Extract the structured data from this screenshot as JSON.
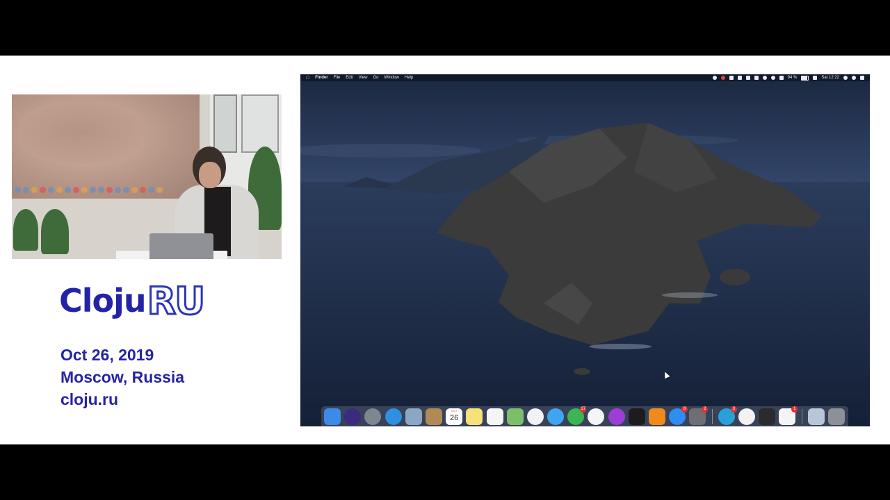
{
  "logo": {
    "text_main": "Cloju",
    "text_accent": "RU"
  },
  "event": {
    "date": "Oct 26, 2019",
    "location": "Moscow, Russia",
    "website": "cloju.ru"
  },
  "menubar": {
    "app": "Finder",
    "items": [
      "File",
      "Edit",
      "View",
      "Go",
      "Window",
      "Help"
    ],
    "battery": "94 %",
    "clock": "Sat 12:22"
  },
  "dock": {
    "calendar": {
      "month": "OCT",
      "day": "26"
    },
    "items": [
      {
        "name": "finder",
        "color": "#3d8be6"
      },
      {
        "name": "siri",
        "color": "#3b2a7e"
      },
      {
        "name": "launchpad",
        "color": "#7f8690"
      },
      {
        "name": "safari",
        "color": "#2f8fe0"
      },
      {
        "name": "mail",
        "color": "#8aa7c4"
      },
      {
        "name": "contacts",
        "color": "#b08a55"
      },
      {
        "name": "calendar",
        "color": "#ffffff"
      },
      {
        "name": "notes",
        "color": "#f7e27a"
      },
      {
        "name": "reminders",
        "color": "#f5f5f5"
      },
      {
        "name": "maps",
        "color": "#7bbf6a"
      },
      {
        "name": "photos",
        "color": "#f2f2f2"
      },
      {
        "name": "messages",
        "color": "#3ea6f0"
      },
      {
        "name": "facetime",
        "color": "#3cb552",
        "badge": "17"
      },
      {
        "name": "music",
        "color": "#f5f5f7"
      },
      {
        "name": "podcasts",
        "color": "#9b3fd4"
      },
      {
        "name": "tv",
        "color": "#1c1c1e"
      },
      {
        "name": "books",
        "color": "#f08a1d"
      },
      {
        "name": "app-store",
        "color": "#2f8cf2",
        "badge": "8"
      },
      {
        "name": "system-preferences",
        "color": "#6d6f74",
        "badge": "2"
      },
      {
        "name": "telegram",
        "color": "#2aa0da",
        "badge": "3"
      },
      {
        "name": "chrome",
        "color": "#f2f2f2"
      },
      {
        "name": "terminal",
        "color": "#2b2b2b"
      },
      {
        "name": "slack",
        "color": "#f4f4f4",
        "badge": "1"
      },
      {
        "name": "documents-folder",
        "color": "#b9c6d6"
      },
      {
        "name": "trash",
        "color": "#8c9097"
      }
    ]
  }
}
